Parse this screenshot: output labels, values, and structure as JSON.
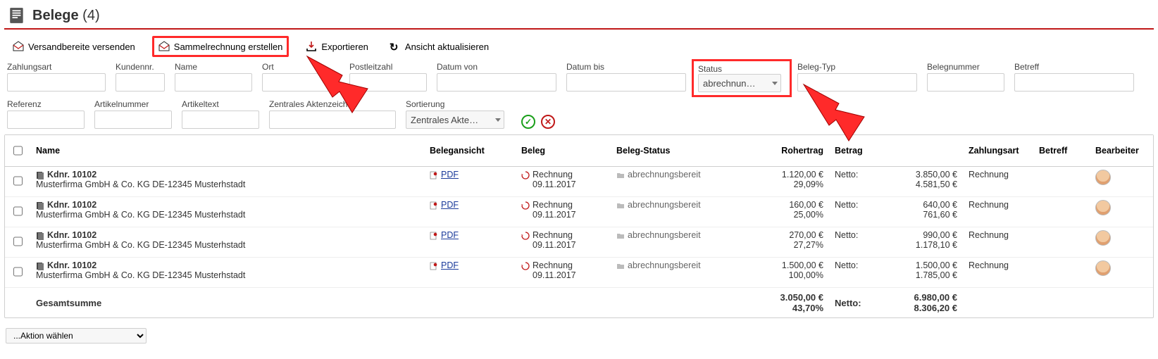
{
  "header": {
    "title": "Belege",
    "count": "(4)"
  },
  "toolbar": {
    "send_ready": "Versandbereite versenden",
    "create_summary": "Sammelrechnung erstellen",
    "export": "Exportieren",
    "refresh": "Ansicht aktualisieren"
  },
  "filters": {
    "row1": {
      "zahlungsart": "Zahlungsart",
      "kundennr": "Kundennr.",
      "name": "Name",
      "ort": "Ort",
      "plz": "Postleitzahl",
      "datum_von": "Datum von",
      "datum_bis": "Datum bis",
      "status": "Status",
      "status_value": "abrechnun…",
      "beleg_typ": "Beleg-Typ",
      "belegnummer": "Belegnummer",
      "betreff": "Betreff"
    },
    "row2": {
      "referenz": "Referenz",
      "artikelnummer": "Artikelnummer",
      "artikeltext": "Artikeltext",
      "zak": "Zentrales Aktenzeichen",
      "sortierung": "Sortierung",
      "sortierung_value": "Zentrales Akte…"
    }
  },
  "table": {
    "headers": {
      "name": "Name",
      "belegansicht": "Belegansicht",
      "beleg": "Beleg",
      "beleg_status": "Beleg-Status",
      "rohertrag": "Rohertrag",
      "betrag": "Betrag",
      "zahlungsart": "Zahlungsart",
      "betreff": "Betreff",
      "bearbeiter": "Bearbeiter"
    },
    "rows": [
      {
        "title": "Kdnr. 10102",
        "sub": "Musterfirma GmbH & Co. KG DE-12345 Musterhstadt",
        "pdf": "PDF",
        "beleg_type": "Rechnung",
        "beleg_date": "09.11.2017",
        "status": "abrechnungsbereit",
        "roh_1": "1.120,00 €",
        "roh_2": "29,09%",
        "betrag_lbl": "Netto:",
        "betrag_1": "3.850,00 €",
        "betrag_2": "4.581,50 €",
        "zahlungsart": "Rechnung"
      },
      {
        "title": "Kdnr. 10102",
        "sub": "Musterfirma GmbH & Co. KG DE-12345 Musterhstadt",
        "pdf": "PDF",
        "beleg_type": "Rechnung",
        "beleg_date": "09.11.2017",
        "status": "abrechnungsbereit",
        "roh_1": "160,00 €",
        "roh_2": "25,00%",
        "betrag_lbl": "Netto:",
        "betrag_1": "640,00 €",
        "betrag_2": "761,60 €",
        "zahlungsart": "Rechnung"
      },
      {
        "title": "Kdnr. 10102",
        "sub": "Musterfirma GmbH & Co. KG DE-12345 Musterhstadt",
        "pdf": "PDF",
        "beleg_type": "Rechnung",
        "beleg_date": "09.11.2017",
        "status": "abrechnungsbereit",
        "roh_1": "270,00 €",
        "roh_2": "27,27%",
        "betrag_lbl": "Netto:",
        "betrag_1": "990,00 €",
        "betrag_2": "1.178,10 €",
        "zahlungsart": "Rechnung"
      },
      {
        "title": "Kdnr. 10102",
        "sub": "Musterfirma GmbH & Co. KG DE-12345 Musterhstadt",
        "pdf": "PDF",
        "beleg_type": "Rechnung",
        "beleg_date": "09.11.2017",
        "status": "abrechnungsbereit",
        "roh_1": "1.500,00 €",
        "roh_2": "100,00%",
        "betrag_lbl": "Netto:",
        "betrag_1": "1.500,00 €",
        "betrag_2": "1.785,00 €",
        "zahlungsart": "Rechnung"
      }
    ],
    "footer": {
      "label": "Gesamtsumme",
      "roh_1": "3.050,00 €",
      "roh_2": "43,70%",
      "betrag_lbl": "Netto:",
      "betrag_1": "6.980,00 €",
      "betrag_2": "8.306,20 €"
    }
  },
  "bottom": {
    "action_placeholder": "...Aktion wählen"
  }
}
